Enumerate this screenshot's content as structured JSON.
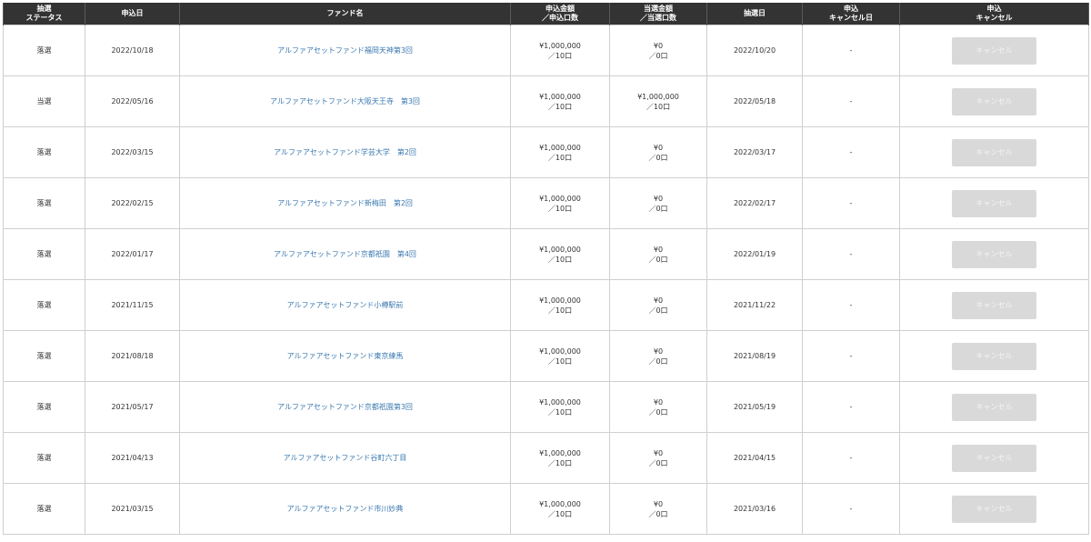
{
  "headers": [
    [
      "抽選",
      "ステータス"
    ],
    [
      "申込日"
    ],
    [
      "ファンド名"
    ],
    [
      "申込金額",
      "／申込口数"
    ],
    [
      "当選金額",
      "／当選口数"
    ],
    [
      "抽選日"
    ],
    [
      "申込",
      "キャンセル日"
    ],
    [
      "申込",
      "キャンセル"
    ]
  ],
  "rows": [
    {
      "status": "落選",
      "apply_date": "2022/10/18",
      "fund": "アルファアセットファンド福岡天神第3回",
      "apply_amount": "¥1,000,000",
      "apply_units": "／10口",
      "win_amount": "¥0",
      "win_units": "／0口",
      "lottery_date": "2022/10/20",
      "cancel_date": "-",
      "cancel_label": "キャンセル"
    },
    {
      "status": "当選",
      "apply_date": "2022/05/16",
      "fund": "アルファアセットファンド大阪天王寺　第3回",
      "apply_amount": "¥1,000,000",
      "apply_units": "／10口",
      "win_amount": "¥1,000,000",
      "win_units": "／10口",
      "lottery_date": "2022/05/18",
      "cancel_date": "-",
      "cancel_label": "キャンセル"
    },
    {
      "status": "落選",
      "apply_date": "2022/03/15",
      "fund": "アルファアセットファンド学芸大学　第2回",
      "apply_amount": "¥1,000,000",
      "apply_units": "／10口",
      "win_amount": "¥0",
      "win_units": "／0口",
      "lottery_date": "2022/03/17",
      "cancel_date": "-",
      "cancel_label": "キャンセル"
    },
    {
      "status": "落選",
      "apply_date": "2022/02/15",
      "fund": "アルファアセットファンド新梅田　第2回",
      "apply_amount": "¥1,000,000",
      "apply_units": "／10口",
      "win_amount": "¥0",
      "win_units": "／0口",
      "lottery_date": "2022/02/17",
      "cancel_date": "-",
      "cancel_label": "キャンセル"
    },
    {
      "status": "落選",
      "apply_date": "2022/01/17",
      "fund": "アルファアセットファンド京都祇園　第4回",
      "apply_amount": "¥1,000,000",
      "apply_units": "／10口",
      "win_amount": "¥0",
      "win_units": "／0口",
      "lottery_date": "2022/01/19",
      "cancel_date": "-",
      "cancel_label": "キャンセル"
    },
    {
      "status": "落選",
      "apply_date": "2021/11/15",
      "fund": "アルファアセットファンド小樽駅前",
      "apply_amount": "¥1,000,000",
      "apply_units": "／10口",
      "win_amount": "¥0",
      "win_units": "／0口",
      "lottery_date": "2021/11/22",
      "cancel_date": "-",
      "cancel_label": "キャンセル"
    },
    {
      "status": "落選",
      "apply_date": "2021/08/18",
      "fund": "アルファアセットファンド東京練馬",
      "apply_amount": "¥1,000,000",
      "apply_units": "／10口",
      "win_amount": "¥0",
      "win_units": "／0口",
      "lottery_date": "2021/08/19",
      "cancel_date": "-",
      "cancel_label": "キャンセル"
    },
    {
      "status": "落選",
      "apply_date": "2021/05/17",
      "fund": "アルファアセットファンド京都祇園第3回",
      "apply_amount": "¥1,000,000",
      "apply_units": "／10口",
      "win_amount": "¥0",
      "win_units": "／0口",
      "lottery_date": "2021/05/19",
      "cancel_date": "-",
      "cancel_label": "キャンセル"
    },
    {
      "status": "落選",
      "apply_date": "2021/04/13",
      "fund": "アルファアセットファンド谷町六丁目",
      "apply_amount": "¥1,000,000",
      "apply_units": "／10口",
      "win_amount": "¥0",
      "win_units": "／0口",
      "lottery_date": "2021/04/15",
      "cancel_date": "-",
      "cancel_label": "キャンセル"
    },
    {
      "status": "落選",
      "apply_date": "2021/03/15",
      "fund": "アルファアセットファンド市川妙典",
      "apply_amount": "¥1,000,000",
      "apply_units": "／10口",
      "win_amount": "¥0",
      "win_units": "／0口",
      "lottery_date": "2021/03/16",
      "cancel_date": "-",
      "cancel_label": "キャンセル"
    }
  ]
}
